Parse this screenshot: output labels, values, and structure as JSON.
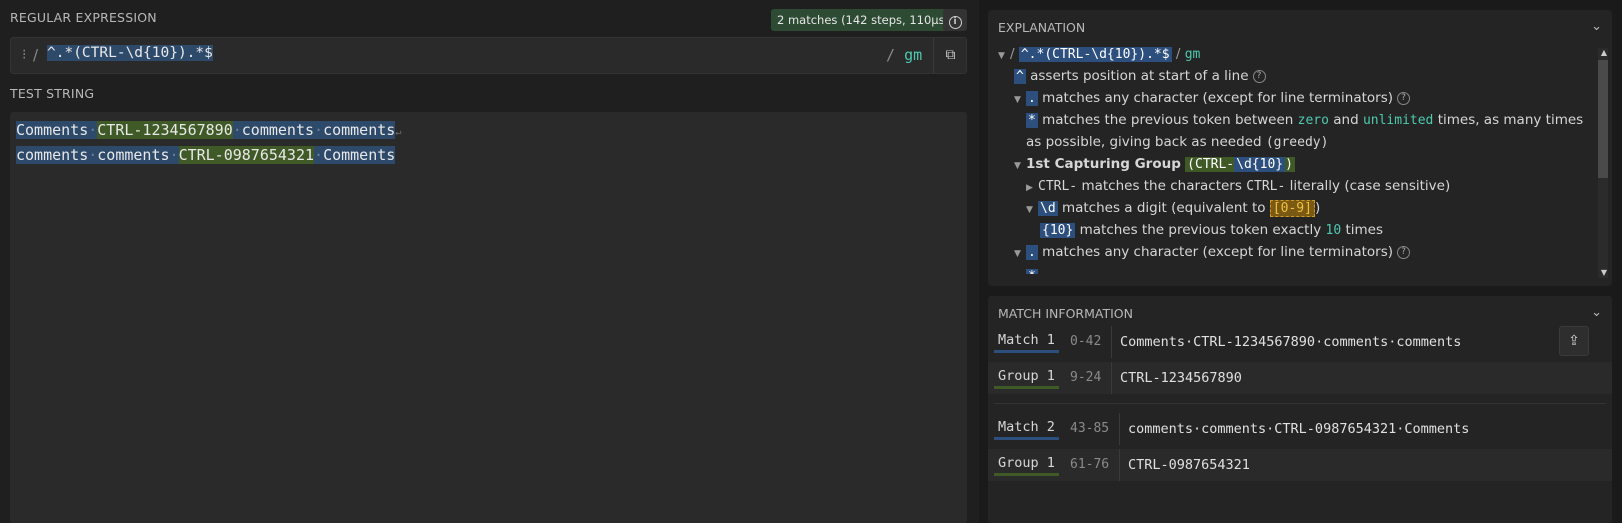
{
  "regex_section": {
    "title": "REGULAR EXPRESSION",
    "match_badge": "2 matches (142 steps, 110µs)",
    "delimiter_open": "/",
    "pattern": "^.*(CTRL-\\d{10}).*$",
    "delimiter_close": "/",
    "flags": "gm"
  },
  "test_section": {
    "title": "TEST STRING",
    "line1": {
      "pre": "Comments",
      "group": "CTRL-1234567890",
      "mid1": "comments",
      "mid2": "comments"
    },
    "line2": {
      "pre1": "comments",
      "pre2": "comments",
      "group": "CTRL-0987654321",
      "post": "Comments"
    }
  },
  "explanation": {
    "title": "EXPLANATION",
    "root_pattern": "^.*(CTRL-\\d{10}).*$",
    "root_flags": "gm",
    "caret_text": "asserts position at start of a line",
    "dot_text": "matches any character (except for line terminators)",
    "star_text_1": "matches the previous token between",
    "star_zero": "zero",
    "star_and": "and",
    "star_unlimited": "unlimited",
    "star_text_2": "times, as many times",
    "star_text_3": "as possible, giving back as needed",
    "star_greedy": "(greedy)",
    "group_label": "1st Capturing Group",
    "group_pattern_prefix": "(CTRL-",
    "group_pattern_token": "\\d{10}",
    "group_pattern_suffix": ")",
    "ctrl_token": "CTRL-",
    "ctrl_text_1": "matches the characters",
    "ctrl_literal": "CTRL-",
    "ctrl_text_2": "literally (case sensitive)",
    "digit_token": "\\d",
    "digit_text": "matches a digit (equivalent to",
    "digit_class": "[0-9]",
    "digit_close": ")",
    "quant_token": "{10}",
    "quant_text_1": "matches the previous token exactly",
    "quant_num": "10",
    "quant_text_2": "times",
    "dot2_text": "matches any character (except for line terminators)"
  },
  "match_info": {
    "title": "MATCH INFORMATION",
    "rows": [
      {
        "label": "Match 1",
        "range": "0-42",
        "text": "Comments·CTRL-1234567890·comments·comments"
      },
      {
        "label": "Group 1",
        "range": "9-24",
        "text": "CTRL-1234567890"
      },
      {
        "label": "Match 2",
        "range": "43-85",
        "text": "comments·comments·CTRL-0987654321·Comments"
      },
      {
        "label": "Group 1",
        "range": "61-76",
        "text": "CTRL-0987654321"
      }
    ]
  },
  "colors": {
    "match_highlight": "#2e4a6b",
    "group_highlight": "#3f5a26",
    "accent_green": "#4ec9b0",
    "badge_bg": "#2d4a33"
  }
}
